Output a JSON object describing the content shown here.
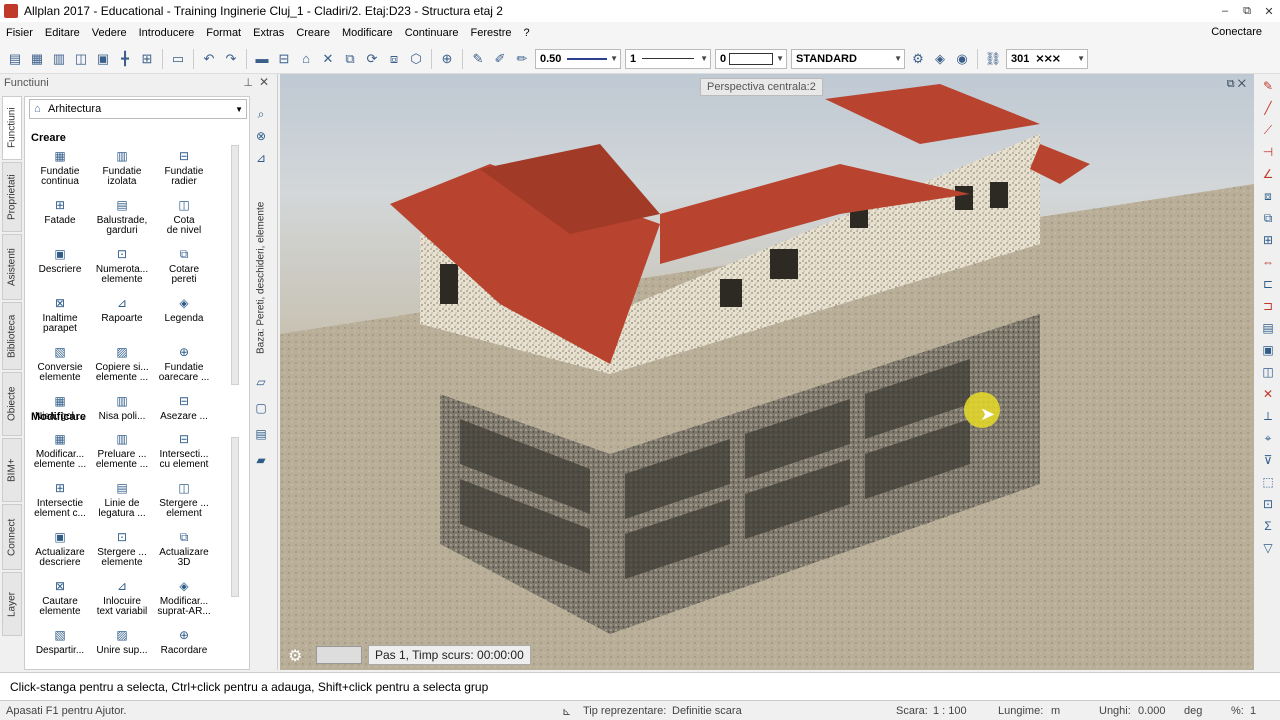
{
  "titlebar": {
    "title": "Allplan 2017 - Educational - Training Inginerie Cluj_1 - Cladiri/2. Etaj:D23 - Structura etaj 2",
    "minimize": "–",
    "maximize": "⧉",
    "close": "✕"
  },
  "menubar": {
    "items": [
      "Fisier",
      "Editare",
      "Vedere",
      "Introducere",
      "Format",
      "Extras",
      "Creare",
      "Modificare",
      "Continuare",
      "Ferestre",
      "?"
    ],
    "conectare": "Conectare"
  },
  "toolbar": {
    "pen_value": "0.50",
    "line_value": "1",
    "color_value": "0",
    "layer_value": "STANDARD",
    "number_value": "301"
  },
  "functions_panel": {
    "header": "Functiuni",
    "tabs": [
      "Functiuni",
      "Proprietati",
      "Asistenti",
      "Biblioteca",
      "Obiecte",
      "BIM+",
      "Connect",
      "Layer"
    ],
    "module": "Arhitectura",
    "section_create": "Creare",
    "create_items": [
      {
        "label": "Fundatie\ncontinua",
        "icon": "foundation-strip-icon"
      },
      {
        "label": "Fundatie\nizolata",
        "icon": "foundation-isolated-icon"
      },
      {
        "label": "Fundatie\nradier",
        "icon": "foundation-raft-icon"
      },
      {
        "label": "Fatade",
        "icon": "facade-icon"
      },
      {
        "label": "Balustrade,\ngarduri",
        "icon": "railing-icon"
      },
      {
        "label": "Cota\nde nivel",
        "icon": "level-dimension-icon"
      },
      {
        "label": "Descriere",
        "icon": "label-icon"
      },
      {
        "label": "Numerota...\nelemente",
        "icon": "numbering-icon"
      },
      {
        "label": "Cotare\npereti",
        "icon": "wall-dimension-icon"
      },
      {
        "label": "Inaltime\nparapet",
        "icon": "parapet-height-icon"
      },
      {
        "label": "Rapoarte",
        "icon": "reports-icon"
      },
      {
        "label": "Legenda",
        "icon": "legend-icon"
      },
      {
        "label": "Conversie\nelemente",
        "icon": "convert-elements-icon"
      },
      {
        "label": "Copiere si...\nelemente ...",
        "icon": "copy-elements-icon"
      },
      {
        "label": "Fundatie\noarecare ...",
        "icon": "foundation-any-icon"
      },
      {
        "label": "Nisa, gol ...",
        "icon": "niche-icon"
      },
      {
        "label": "Nisa poli...",
        "icon": "niche-poly-icon"
      },
      {
        "label": "Asezare ...",
        "icon": "placement-icon"
      }
    ],
    "section_modify": "Modificare",
    "modify_items": [
      {
        "label": "Modificar...\nelemente ...",
        "icon": "modify-elements-icon"
      },
      {
        "label": "Preluare ...\nelemente ...",
        "icon": "take-over-icon"
      },
      {
        "label": "Intersecti...\ncu element",
        "icon": "intersect-element-icon"
      },
      {
        "label": "Intersectie\nelement c...",
        "icon": "intersect-icon"
      },
      {
        "label": "Linie de\nlegatura ...",
        "icon": "connection-line-icon"
      },
      {
        "label": "Stergere ...\nelement",
        "icon": "delete-element-icon"
      },
      {
        "label": "Actualizare\ndescriere",
        "icon": "update-label-icon"
      },
      {
        "label": "Stergere ...\nelemente",
        "icon": "delete-elements-icon"
      },
      {
        "label": "Actualizare\n3D",
        "icon": "update-3d-icon"
      },
      {
        "label": "Cautare\nelemente",
        "icon": "search-elements-icon"
      },
      {
        "label": "Inlocuire\ntext variabil",
        "icon": "replace-text-icon"
      },
      {
        "label": "Modificar...\nsuprat-AR...",
        "icon": "modify-surface-icon"
      },
      {
        "label": "Despartir...",
        "icon": "split-icon"
      },
      {
        "label": "Unire sup...",
        "icon": "join-surface-icon"
      },
      {
        "label": "Racordare",
        "icon": "fillet-icon"
      }
    ],
    "side_tab": "Baza: Pereti, deschideri, elemente"
  },
  "viewport": {
    "label": "Perspectiva centrala:2",
    "render_status": "Pas 1, Timp scurs: 00:00:00"
  },
  "hint": "Click-stanga pentru a selecta, Ctrl+click pentru a adauga, Shift+click pentru a selecta grup",
  "statusbar": {
    "help": "Apasati F1 pentru Ajutor.",
    "representation_label": "Tip reprezentare:",
    "representation_value": "Definitie scara",
    "scale_label": "Scara:",
    "scale_value": "1 : 100",
    "length_label": "Lungime:",
    "length_value": "m",
    "angle_label": "Unghi:",
    "angle_value": "0.000",
    "angle_unit": "deg",
    "percent_label": "%:",
    "percent_value": "1"
  },
  "colors": {
    "roof": "#b8432e",
    "wall": "#e9e1cf",
    "frame": "#6f6a5e",
    "ground": "#b9ae98",
    "sky": "#bfc9d3",
    "accent_red": "#c0392b",
    "accent_blue": "#2f5d8a"
  }
}
